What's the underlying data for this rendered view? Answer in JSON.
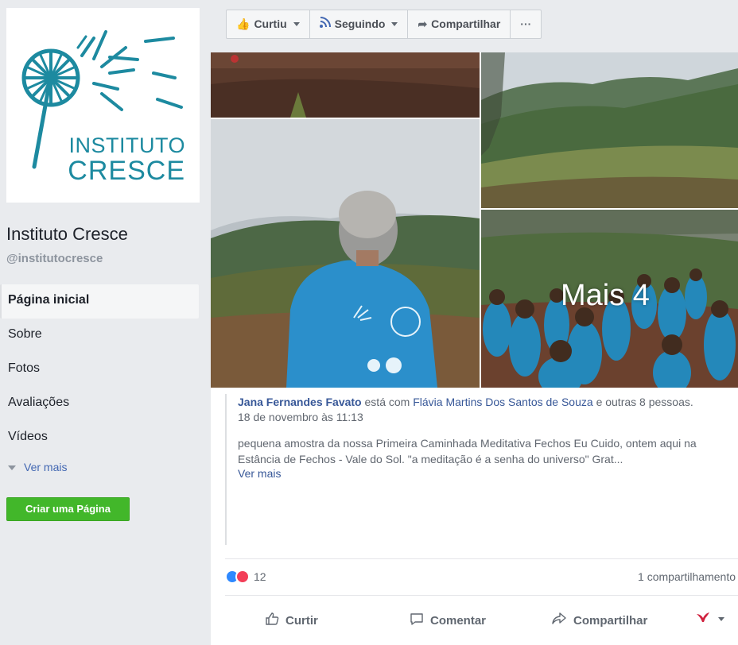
{
  "page": {
    "logo_text_line1": "INSTITUTO",
    "logo_text_line2": "CRESCE",
    "name": "Instituto Cresce",
    "handle": "@institutocresce",
    "brand_color": "#1d8aa0"
  },
  "sidebar": {
    "items": [
      {
        "label": "Página inicial",
        "active": true
      },
      {
        "label": "Sobre"
      },
      {
        "label": "Fotos"
      },
      {
        "label": "Avaliações"
      },
      {
        "label": "Vídeos"
      }
    ],
    "see_more": "Ver mais",
    "create_page": "Criar uma Página"
  },
  "action_bar": {
    "liked": "Curtiu",
    "following": "Seguindo",
    "share": "Compartilhar",
    "more": "···"
  },
  "post": {
    "more_photos": "Mais 4",
    "author": "Jana Fernandes Favato",
    "with_text": "está com",
    "tagged": "Flávia Martins Dos Santos de Souza",
    "and_others": "e outras 8 pessoas.",
    "timestamp": "18 de novembro às 11:13",
    "text": "pequena amostra da nossa Primeira Caminhada Meditativa Fechos Eu Cuido, ontem aqui na Estância de Fechos - Vale do Sol. \"a meditação é a senha do universo\" Grat...",
    "see_more": "Ver mais",
    "reactions_count": "12",
    "shares": "1 compartilhamento"
  },
  "post_actions": {
    "like": "Curtir",
    "comment": "Comentar",
    "share": "Compartilhar"
  }
}
